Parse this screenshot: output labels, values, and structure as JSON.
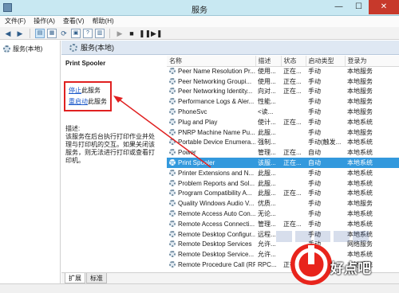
{
  "window": {
    "title": "服务"
  },
  "menubar": {
    "items": [
      "文件(F)",
      "操作(A)",
      "查看(V)",
      "帮助(H)"
    ]
  },
  "tree": {
    "root_label": "服务(本地)"
  },
  "pane": {
    "header": "服务(本地)"
  },
  "detail": {
    "service_name": "Print Spooler",
    "stop_link": "停止",
    "stop_suffix": "此服务",
    "restart_link": "重启动",
    "restart_suffix": "此服务",
    "desc_label": "描述:",
    "desc_text": "该服务在后台执行打印作业并处理与打印机的交互。如果关闭该服务，则无法进行打印或查看打印机。"
  },
  "table": {
    "columns": [
      "名称",
      "描述",
      "状态",
      "启动类型",
      "登录为"
    ],
    "rows": [
      [
        "Peer Name Resolution Pr...",
        "使用...",
        "正在...",
        "手动",
        "本地服务"
      ],
      [
        "Peer Networking Groupi...",
        "使用...",
        "正在...",
        "手动",
        "本地服务"
      ],
      [
        "Peer Networking Identity...",
        "向对...",
        "正在...",
        "手动",
        "本地服务"
      ],
      [
        "Performance Logs & Aler...",
        "性能...",
        "",
        "手动",
        "本地服务"
      ],
      [
        "PhoneSvc",
        "<读...",
        "",
        "手动",
        "本地服务"
      ],
      [
        "Plug and Play",
        "使计...",
        "正在...",
        "手动",
        "本地系统"
      ],
      [
        "PNRP Machine Name Pu...",
        "此服...",
        "",
        "手动",
        "本地服务"
      ],
      [
        "Portable Device Enumera...",
        "强制...",
        "",
        "手动(触发...",
        "本地系统"
      ],
      [
        "Power",
        "管理...",
        "正在...",
        "自动",
        "本地系统"
      ],
      [
        "Print Spooler",
        "该服...",
        "正在...",
        "自动",
        "本地系统"
      ],
      [
        "Printer Extensions and N...",
        "此服...",
        "",
        "手动",
        "本地系统"
      ],
      [
        "Problem Reports and Sol...",
        "此服...",
        "",
        "手动",
        "本地系统"
      ],
      [
        "Program Compatibility A...",
        "此服...",
        "正在...",
        "手动",
        "本地系统"
      ],
      [
        "Quality Windows Audio V...",
        "优质...",
        "",
        "手动",
        "本地服务"
      ],
      [
        "Remote Access Auto Con...",
        "无论...",
        "",
        "手动",
        "本地系统"
      ],
      [
        "Remote Access Connecti...",
        "管理...",
        "正在...",
        "手动",
        "本地系统"
      ],
      [
        "Remote Desktop Configur...",
        "远程...",
        "",
        "手动",
        "本地系统"
      ],
      [
        "Remote Desktop Services",
        "允许...",
        "",
        "手动",
        "网络服务"
      ],
      [
        "Remote Desktop Service...",
        "允许...",
        "",
        "手动",
        "本地系统"
      ],
      [
        "Remote Procedure Call (RPC)",
        "RPC...",
        "正在...",
        "自动",
        "本地系统"
      ]
    ],
    "selected_index": 9
  },
  "tabs": [
    "扩展",
    "标准"
  ],
  "watermark": {
    "text": "好点吧"
  },
  "colors": {
    "selection": "#3399dd",
    "annotation": "#e02020"
  }
}
